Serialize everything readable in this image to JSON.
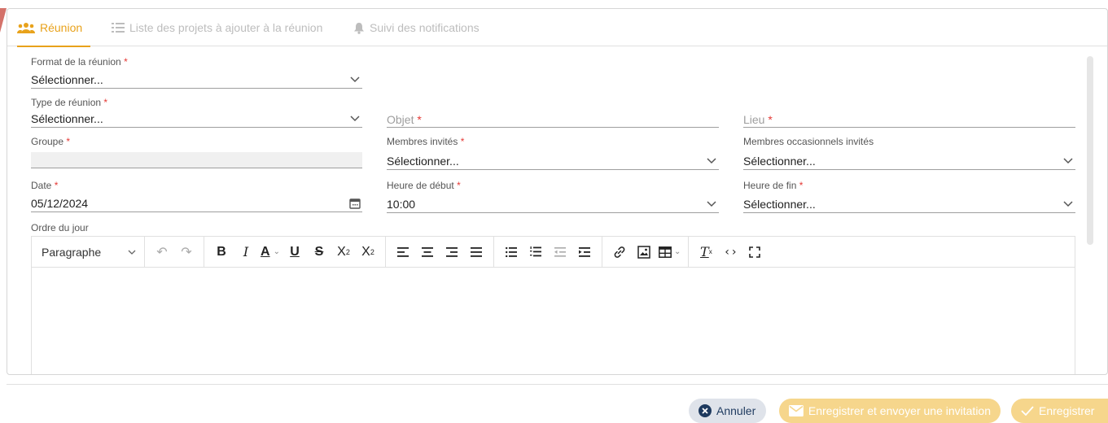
{
  "tabs": [
    {
      "label": "Réunion",
      "icon": "users-icon",
      "active": true
    },
    {
      "label": "Liste des projets à ajouter à la réunion",
      "icon": "list-icon",
      "active": false
    },
    {
      "label": "Suivi des notifications",
      "icon": "bell-icon",
      "active": false
    }
  ],
  "form": {
    "format": {
      "label": "Format de la réunion",
      "value": "Sélectionner..."
    },
    "type": {
      "label": "Type de réunion",
      "value": "Sélectionner..."
    },
    "objet": {
      "placeholder": "Objet"
    },
    "lieu": {
      "placeholder": "Lieu"
    },
    "groupe": {
      "label": "Groupe",
      "value": ""
    },
    "membres": {
      "label": "Membres invités",
      "value": "Sélectionner..."
    },
    "membres_occ": {
      "label": "Membres occasionnels invités",
      "value": "Sélectionner..."
    },
    "date": {
      "label": "Date",
      "value": "05/12/2024"
    },
    "heure_debut": {
      "label": "Heure de début",
      "value": "10:00"
    },
    "heure_fin": {
      "label": "Heure de fin",
      "value": "Sélectionner..."
    },
    "ordre": {
      "label": "Ordre du jour"
    },
    "required_mark": "*"
  },
  "editor": {
    "paragraph_select": "Paragraphe"
  },
  "footer": {
    "cancel": "Annuler",
    "send_invite": "Enregistrer et envoyer une invitation",
    "save": "Enregistrer"
  },
  "colors": {
    "accent": "#e8a21b",
    "required": "#e53935",
    "cancel_bg": "#dfe3ea",
    "primary_disabled_bg": "#f6d68c"
  }
}
